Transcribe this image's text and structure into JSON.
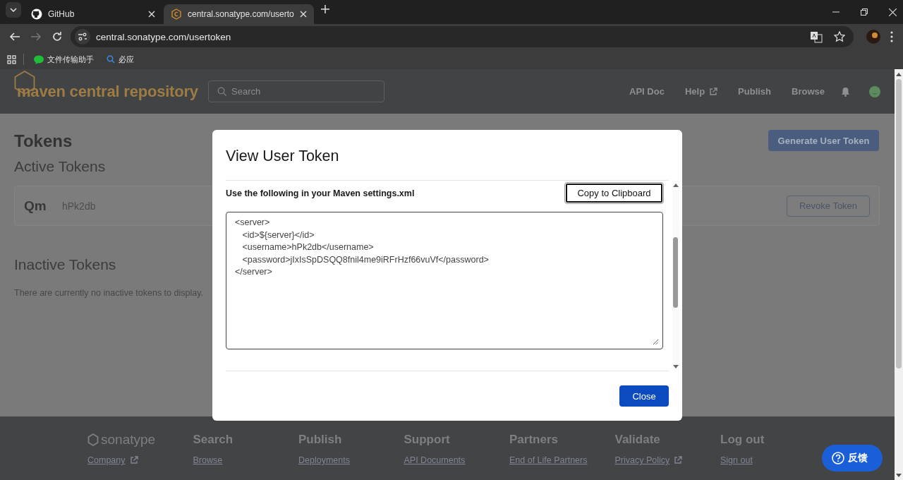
{
  "browser": {
    "tabs": [
      {
        "title": "GitHub",
        "selected": false
      },
      {
        "title": "central.sonatype.com/userto",
        "selected": true
      }
    ],
    "nav_buttons": [
      {
        "kind": "back",
        "disabled": false
      },
      {
        "kind": "forward",
        "disabled": true
      },
      {
        "kind": "reload",
        "disabled": false
      }
    ],
    "url": "central.sonatype.com/usertoken",
    "bookmarks": [
      {
        "kind": "chat",
        "label": "文件传输助手"
      },
      {
        "kind": "search",
        "label": "必应"
      }
    ]
  },
  "header": {
    "logo": "maven central repository",
    "search": {
      "placeholder": "Search"
    },
    "nav": [
      {
        "label": "API Doc",
        "external": false
      },
      {
        "label": "Help",
        "external": true
      },
      {
        "label": "Publish",
        "external": false
      },
      {
        "label": "Browse",
        "external": false
      }
    ]
  },
  "page": {
    "title": "Tokens",
    "generate_button": "Generate User Token",
    "active_heading": "Active Tokens",
    "active_tokens": [
      {
        "name": "Qm",
        "token_id": "hPk2db",
        "action": "Revoke Token"
      }
    ],
    "inactive_heading": "Inactive Tokens",
    "inactive_message": "There are currently no inactive tokens to display."
  },
  "modal": {
    "title": "View User Token",
    "instruction": "Use the following in your Maven settings.xml",
    "copy_button": "Copy to Clipboard",
    "settings_xml": "<server>\n\t<id>${server}</id>\n\t<username>hPk2db</username>\n\t<password>jIxIsSpDSQQ8fnil4me9iRFrHzf66vuVf</password>\n</server>",
    "close_button": "Close"
  },
  "footer": {
    "brand": "sonatype",
    "brand_links": [
      {
        "label": "Company",
        "external": true
      }
    ],
    "columns": [
      {
        "heading": "Search",
        "links": [
          {
            "label": "Browse",
            "external": false
          }
        ]
      },
      {
        "heading": "Publish",
        "links": [
          {
            "label": "Deployments",
            "external": false
          }
        ]
      },
      {
        "heading": "Support",
        "links": [
          {
            "label": "API Documents",
            "external": false
          }
        ]
      },
      {
        "heading": "Partners",
        "links": [
          {
            "label": "End of Life Partners",
            "external": false
          }
        ]
      },
      {
        "heading": "Validate",
        "links": [
          {
            "label": "Privacy Policy",
            "external": true
          }
        ]
      },
      {
        "heading": "Log out",
        "links": [
          {
            "label": "Sign out",
            "external": false
          }
        ]
      }
    ]
  },
  "feedback_button": "反馈"
}
